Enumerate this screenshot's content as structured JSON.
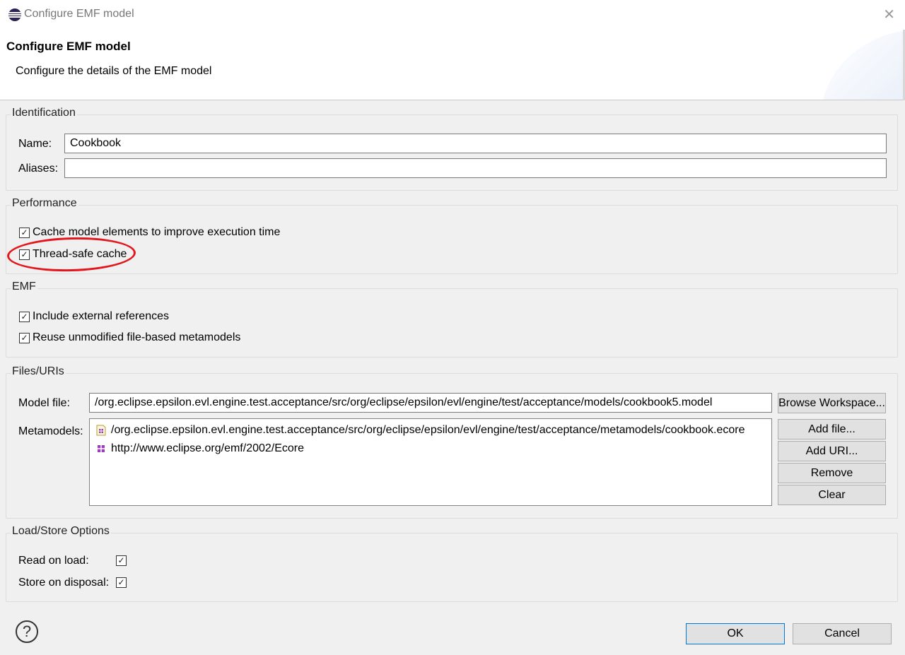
{
  "window": {
    "title": "Configure EMF model",
    "close_glyph": "✕"
  },
  "header": {
    "title": "Configure EMF model",
    "description": "Configure the details of the EMF model"
  },
  "identification": {
    "group_title": "Identification",
    "name_label": "Name:",
    "name_value": "Cookbook",
    "aliases_label": "Aliases:",
    "aliases_value": ""
  },
  "performance": {
    "group_title": "Performance",
    "cache_label": "Cache model elements to improve execution time",
    "cache_checked": true,
    "threadsafe_label": "Thread-safe cache",
    "threadsafe_checked": true,
    "annotation_color": "#e4161d"
  },
  "emf": {
    "group_title": "EMF",
    "include_refs_label": "Include external references",
    "include_refs_checked": true,
    "reuse_label": "Reuse unmodified file-based metamodels",
    "reuse_checked": true
  },
  "files": {
    "group_title": "Files/URIs",
    "model_file_label": "Model file:",
    "model_file_value": "/org.eclipse.epsilon.evl.engine.test.acceptance/src/org/eclipse/epsilon/evl/engine/test/acceptance/models/cookbook5.model",
    "browse_label": "Browse Workspace...",
    "metamodels_label": "Metamodels:",
    "metamodels": [
      {
        "icon": "ecore-file-icon",
        "text": "/org.eclipse.epsilon.evl.engine.test.acceptance/src/org/eclipse/epsilon/evl/engine/test/acceptance/metamodels/cookbook.ecore"
      },
      {
        "icon": "ecore-package-icon",
        "text": "http://www.eclipse.org/emf/2002/Ecore"
      }
    ],
    "add_file_label": "Add file...",
    "add_uri_label": "Add URI...",
    "remove_label": "Remove",
    "clear_label": "Clear"
  },
  "load_store": {
    "group_title": "Load/Store Options",
    "read_on_load_label": "Read on load:",
    "read_on_load_checked": true,
    "store_on_disposal_label": "Store on disposal:",
    "store_on_disposal_checked": true
  },
  "footer": {
    "help_glyph": "?",
    "ok_label": "OK",
    "cancel_label": "Cancel"
  },
  "check_glyph": "✓"
}
